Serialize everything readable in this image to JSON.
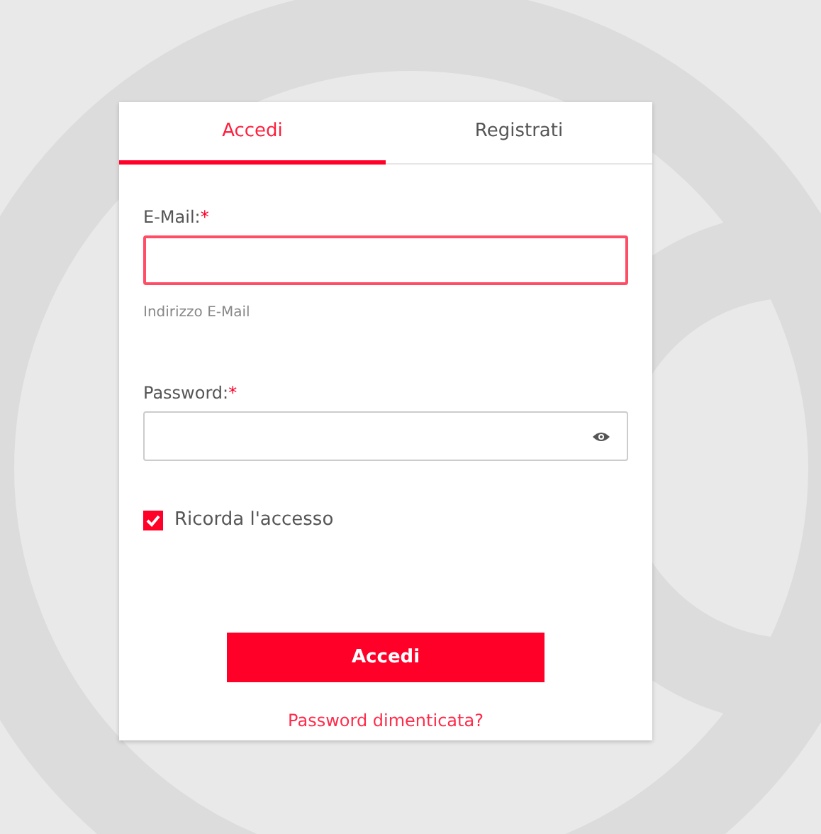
{
  "tabs": [
    {
      "label": "Accedi",
      "selected": true
    },
    {
      "label": "Registrati",
      "selected": false
    }
  ],
  "email": {
    "label": "E-Mail:",
    "required_mark": "*",
    "invalid": true,
    "hint": "Indirizzo E-Mail"
  },
  "password": {
    "label": "Password:",
    "required_mark": "*",
    "invalid": false
  },
  "remember": {
    "label": "Ricorda l'accesso",
    "checked": true
  },
  "submit": "Accedi",
  "forgot_link": "Password dimenticata?"
}
